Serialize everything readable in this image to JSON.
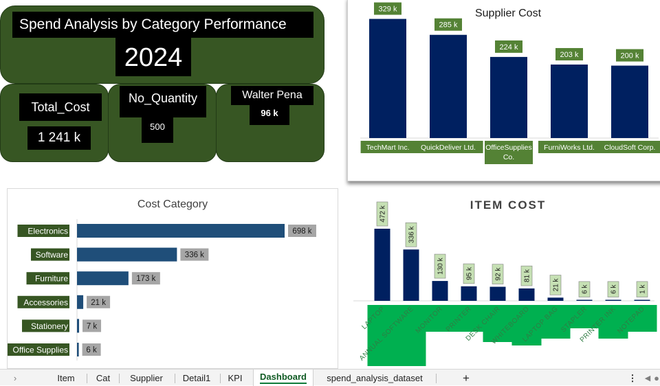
{
  "header": {
    "title": "Spend Analysis by Category Performance",
    "year": "2024"
  },
  "kpis": [
    {
      "label": "Total_Cost",
      "value": "1 241 k"
    },
    {
      "label": "No_Quantity",
      "value": "500"
    },
    {
      "label": "Walter Pena",
      "value": "96 k"
    }
  ],
  "colors": {
    "dark_green": "#375623",
    "navy": "#002060",
    "steel_blue": "#1f4e79",
    "green_label": "#548235",
    "light_green_label": "#c6e0b4",
    "bright_green": "#00b050",
    "grey_label": "#a6a6a6"
  },
  "chart_data": [
    {
      "type": "bar",
      "title": "Supplier Cost",
      "categories": [
        "TechMart Inc.",
        "QuickDeliver Ltd.",
        "OfficeSupplies Co.",
        "FurniWorks Ltd.",
        "CloudSoft Corp."
      ],
      "values": [
        329,
        285,
        224,
        203,
        200
      ],
      "data_labels": [
        "329 k",
        "285 k",
        "224 k",
        "203 k",
        "200 k"
      ],
      "ylim": [
        0,
        330
      ]
    },
    {
      "type": "bar",
      "orientation": "horizontal",
      "title": "Cost Category",
      "categories": [
        "Electronics",
        "Software",
        "Furniture",
        "Accessories",
        "Stationery",
        "Office Supplies"
      ],
      "values": [
        698,
        336,
        173,
        21,
        7,
        6
      ],
      "data_labels": [
        "698 k",
        "336 k",
        "173 k",
        "21 k",
        "7 k",
        "6 k"
      ],
      "xlim": [
        0,
        698
      ]
    },
    {
      "type": "bar",
      "title": "ITEM COST",
      "categories": [
        "LAPTOP",
        "ANNUAL SOFTWARE",
        "MONITOR",
        "PRINTER",
        "DESK CHAIR",
        "WHITEBOARD",
        "LAPTOP BAG",
        "STAPLER",
        "PRINTER INK",
        "NOTEPAD"
      ],
      "values": [
        472,
        336,
        130,
        95,
        92,
        81,
        21,
        6,
        6,
        1
      ],
      "data_labels": [
        "472 k",
        "336 k",
        "130 k",
        "95 k",
        "92 k",
        "81 k",
        "21 k",
        "6 k",
        "6 k",
        "1 k"
      ],
      "ylim": [
        0,
        472
      ]
    }
  ],
  "sheet_tabs": {
    "items": [
      "Item",
      "Cat",
      "Supplier",
      "Detail1",
      "KPI",
      "Dashboard",
      "spend_analysis_dataset"
    ],
    "active": "Dashboard",
    "add_icon": "plus-icon",
    "more_icon": "vertical-ellipsis-icon",
    "nav_icon": "chevron-right-icon"
  }
}
